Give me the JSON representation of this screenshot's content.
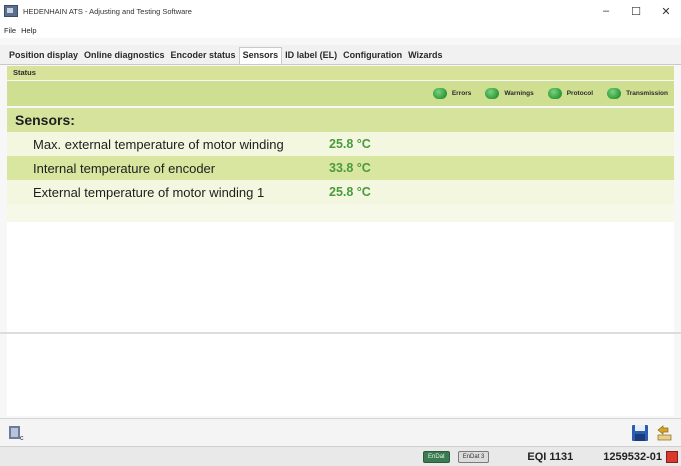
{
  "window": {
    "title": "HEDENHAIN ATS - Adjusting and Testing Software",
    "minimize": "–",
    "maximize": "☐",
    "close": "✕"
  },
  "menu": [
    "File",
    "Help"
  ],
  "tabs": [
    {
      "label": "Position display",
      "active": false
    },
    {
      "label": "Online diagnostics",
      "active": false
    },
    {
      "label": "Encoder status",
      "active": false
    },
    {
      "label": "Sensors",
      "active": true
    },
    {
      "label": "ID label (EL)",
      "active": false
    },
    {
      "label": "Configuration",
      "active": false
    },
    {
      "label": "Wizards",
      "active": false
    }
  ],
  "status": {
    "header": "Status",
    "indicators": [
      {
        "label": "Errors",
        "color": "#2e9a3a"
      },
      {
        "label": "Warnings",
        "color": "#2e9a3a"
      },
      {
        "label": "Protocol",
        "color": "#2e9a3a"
      },
      {
        "label": "Transmission",
        "color": "#2e9a3a"
      }
    ]
  },
  "sensors": {
    "title": "Sensors:",
    "rows": [
      {
        "name": "Max. external temperature of motor winding",
        "value": "25.8 °C"
      },
      {
        "name": "Internal temperature of encoder",
        "value": "33.8 °C"
      },
      {
        "name": "External temperature of motor winding 1",
        "value": "25.8 °C"
      }
    ]
  },
  "statusbar": {
    "indicator1": "EnDat",
    "indicator2": "EnDat 3",
    "device": "EQI 1131",
    "serial": "1259532-01"
  },
  "colors": {
    "accent_green": "#cfdf92",
    "value_green": "#4a9a3e",
    "error_red": "#d73a2f"
  }
}
